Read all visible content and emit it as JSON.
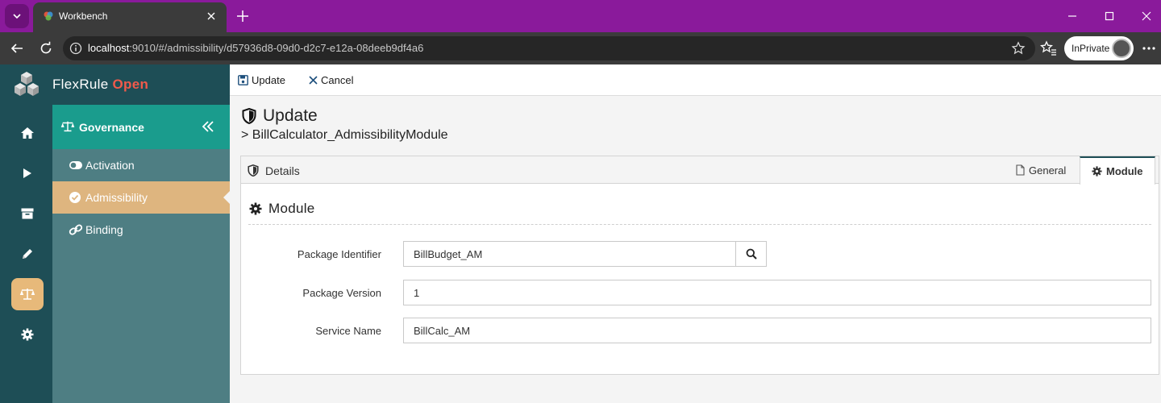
{
  "browser": {
    "tab_title": "Workbench",
    "url_host": "localhost",
    "url_rest": ":9010/#/admissibility/d57936d8-09d0-d2c7-e12a-08deeb9df4a6",
    "inprivate_label": "InPrivate",
    "chrome_color": "#8a1a9b"
  },
  "app": {
    "brand_name": "FlexRule",
    "brand_suffix": "Open",
    "rail_items": [
      {
        "name": "home-icon"
      },
      {
        "name": "play-icon"
      },
      {
        "name": "archive-icon"
      },
      {
        "name": "pencil-icon"
      },
      {
        "name": "scale-icon",
        "active": true
      },
      {
        "name": "gear-icon"
      }
    ],
    "subnav": {
      "title": "Governance",
      "items": [
        {
          "label": "Activation",
          "icon": "toggle-icon"
        },
        {
          "label": "Admissibility",
          "icon": "check-circle-icon",
          "active": true
        },
        {
          "label": "Binding",
          "icon": "link-icon"
        }
      ]
    }
  },
  "toolbar": {
    "update_label": "Update",
    "cancel_label": "Cancel"
  },
  "page": {
    "title": "Update",
    "subtitle": "> BillCalculator_AdmissibilityModule"
  },
  "panel": {
    "title": "Details",
    "tabs": [
      {
        "label": "General",
        "icon": "file-icon"
      },
      {
        "label": "Module",
        "icon": "gear-icon",
        "active": true
      }
    ],
    "section_title": "Module",
    "fields": {
      "package_identifier": {
        "label": "Package Identifier",
        "value": "BillBudget_AM"
      },
      "package_version": {
        "label": "Package Version",
        "value": "1"
      },
      "service_name": {
        "label": "Service Name",
        "value": "BillCalc_AM"
      }
    }
  },
  "colors": {
    "rail": "#1e4e56",
    "subnav": "#4e7e83",
    "subnav_header": "#1a9c8d",
    "active_item": "#deb57f",
    "brand_accent": "#f05a4b"
  }
}
